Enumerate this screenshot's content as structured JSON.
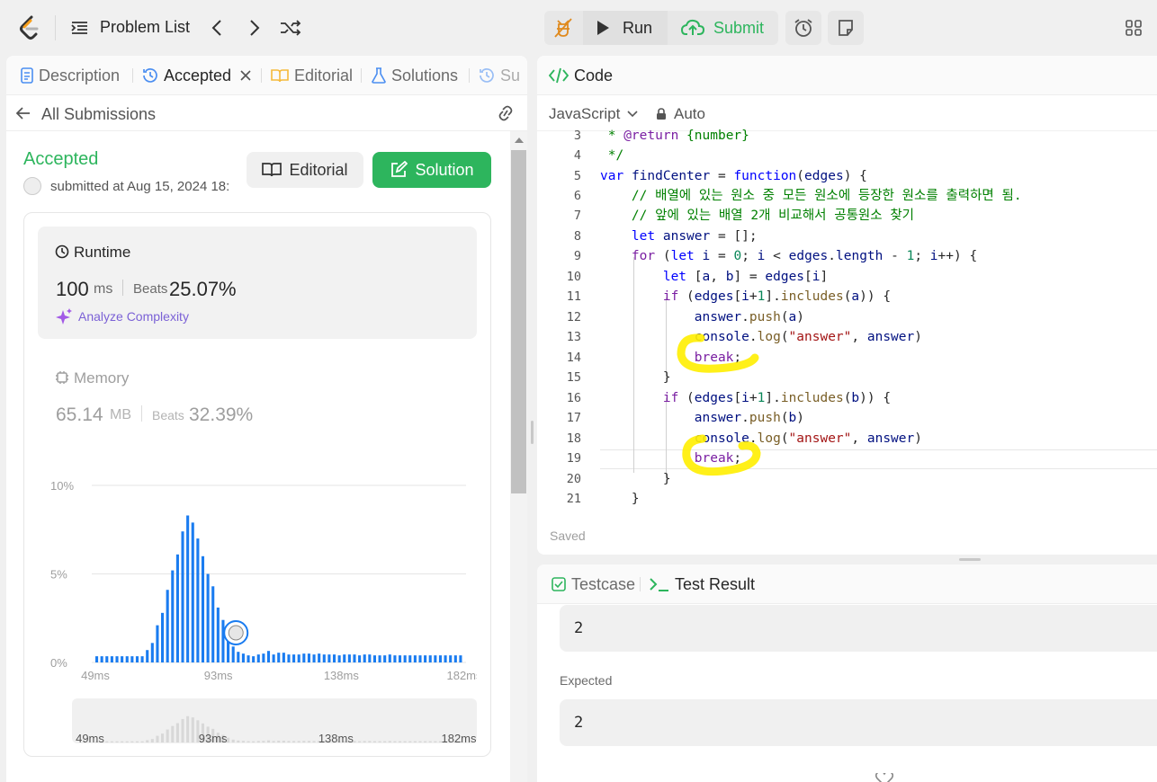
{
  "topbar": {
    "problem_list": "Problem List",
    "run": "Run",
    "submit": "Submit"
  },
  "left_tabs": {
    "description": "Description",
    "accepted": "Accepted",
    "editorial": "Editorial",
    "solutions": "Solutions",
    "submissions_partial": "Su"
  },
  "submission": {
    "back_label": "All Submissions",
    "status": "Accepted",
    "submitted_at": "submitted at Aug 15, 2024 18:",
    "editorial_btn": "Editorial",
    "solution_btn": "Solution"
  },
  "runtime": {
    "title": "Runtime",
    "value": "100",
    "unit": "ms",
    "beats_label": "Beats",
    "beats_value": "25.07%",
    "analyze": "Analyze Complexity"
  },
  "memory": {
    "title": "Memory",
    "value": "65.14",
    "unit": "MB",
    "beats_label": "Beats",
    "beats_value": "32.39%"
  },
  "chart_data": {
    "type": "bar",
    "ylim": [
      0,
      10
    ],
    "yticks": [
      "10%",
      "5%",
      "0%"
    ],
    "xticks": [
      "49ms",
      "93ms",
      "138ms",
      "182ms"
    ],
    "x_range": [
      49,
      182
    ],
    "user_runtime": 100,
    "values": [
      0.35,
      0.35,
      0.35,
      0.35,
      0.35,
      0.35,
      0.35,
      0.35,
      0.35,
      0.35,
      0.7,
      1.1,
      2.1,
      2.8,
      4.1,
      5.2,
      6.1,
      7.4,
      8.3,
      7.9,
      7.0,
      6.0,
      5.0,
      4.3,
      3.1,
      2.4,
      1.5,
      0.9,
      0.6,
      0.5,
      0.4,
      0.35,
      0.45,
      0.5,
      0.65,
      0.45,
      0.55,
      0.55,
      0.45,
      0.45,
      0.45,
      0.5,
      0.5,
      0.45,
      0.5,
      0.45,
      0.45,
      0.45,
      0.4,
      0.45,
      0.45,
      0.45,
      0.4,
      0.45,
      0.45,
      0.4,
      0.4,
      0.4,
      0.45,
      0.4,
      0.4,
      0.4,
      0.4,
      0.4,
      0.4,
      0.4,
      0.4,
      0.4,
      0.4,
      0.4,
      0.4,
      0.4,
      0.4
    ]
  },
  "code_panel": {
    "title": "Code",
    "language": "JavaScript",
    "auto": "Auto",
    "saved": "Saved",
    "line_numbers": [
      "3",
      "4",
      "5",
      "6",
      "7",
      "8",
      "9",
      "10",
      "11",
      "12",
      "13",
      "14",
      "15",
      "16",
      "17",
      "18",
      "19",
      "20",
      "21"
    ]
  },
  "test": {
    "testcase_tab": "Testcase",
    "result_tab": "Test Result",
    "output_value": "2",
    "expected_label": "Expected",
    "expected_value": "2"
  }
}
